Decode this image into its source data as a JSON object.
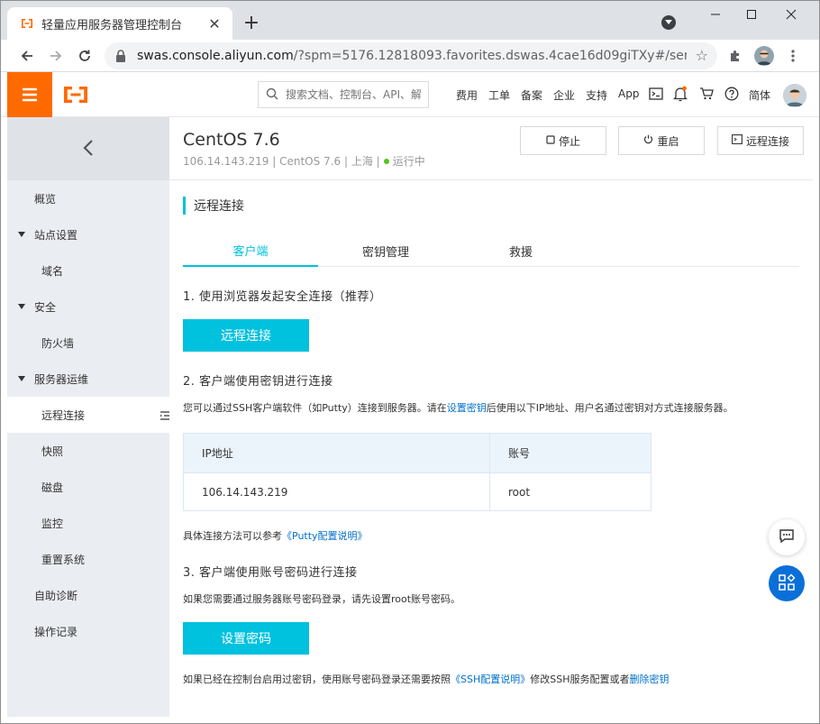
{
  "browser": {
    "tab_title": "轻量应用服务器管理控制台",
    "url_host": "swas.console.aliyun.com",
    "url_rest": "/?spm=5176.12818093.favorites.dswas.4cae16d09giTXy#/server..."
  },
  "header": {
    "search_placeholder": "搜索文档、控制台、API、解",
    "nav": [
      "费用",
      "工单",
      "备案",
      "企业",
      "支持",
      "App"
    ],
    "lang": "简体"
  },
  "sidebar": {
    "items": [
      {
        "label": "概览"
      },
      {
        "label": "站点设置"
      },
      {
        "label": "域名"
      },
      {
        "label": "安全"
      },
      {
        "label": "防火墙"
      },
      {
        "label": "服务器运维"
      },
      {
        "label": "远程连接"
      },
      {
        "label": "快照"
      },
      {
        "label": "磁盘"
      },
      {
        "label": "监控"
      },
      {
        "label": "重置系统"
      },
      {
        "label": "自助诊断"
      },
      {
        "label": "操作记录"
      }
    ]
  },
  "server": {
    "title": "CentOS 7.6",
    "ip": "106.14.143.219",
    "os": "CentOS 7.6",
    "region": "上海",
    "status": "运行中",
    "status_color": "#52c41a"
  },
  "actions": {
    "stop": "停止",
    "restart": "重启",
    "remote": "远程连接"
  },
  "main": {
    "section_title": "远程连接",
    "tabs": [
      "客户端",
      "密钥管理",
      "救援"
    ],
    "step1": "1. 使用浏览器发起安全连接（推荐）",
    "step1_button": "远程连接",
    "step2": "2. 客户端使用密钥进行连接",
    "step2_text_a": "您可以通过SSH客户端软件（如Putty）连接到服务器。请在",
    "step2_link": "设置密钥",
    "step2_text_b": "后使用以下IP地址、用户名通过密钥对方式连接服务器。",
    "table": {
      "headers": [
        "IP地址",
        "账号"
      ],
      "row": [
        "106.14.143.219",
        "root"
      ]
    },
    "ref_text": "具体连接方法可以参考",
    "ref_link": "《Putty配置说明》",
    "step3": "3. 客户端使用账号密码进行连接",
    "step3_text": "如果您需要通过服务器账号密码登录，请先设置root账号密码。",
    "step3_button": "设置密码",
    "footer_text_a": "如果已经在控制台启用过密钥，使用账号密码登录还需要按照",
    "footer_link_a": "《SSH配置说明》",
    "footer_text_b": "修改SSH服务配置或者",
    "footer_link_b": "删除密钥"
  },
  "colors": {
    "brand": "#ff6a00",
    "accent": "#00c1de",
    "link": "#0070cc"
  }
}
